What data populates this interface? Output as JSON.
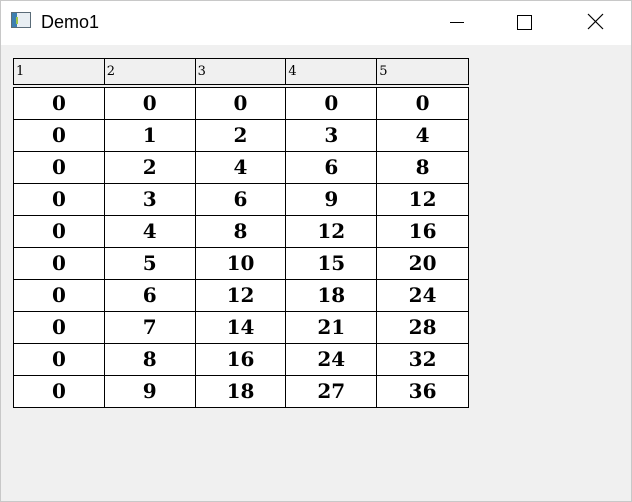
{
  "window": {
    "title": "Demo1",
    "controls": {
      "minimize": "minimize-icon",
      "maximize": "maximize-icon",
      "close": "close-icon"
    }
  },
  "table": {
    "headers": [
      "1",
      "2",
      "3",
      "4",
      "5"
    ],
    "rows": [
      [
        "0",
        "0",
        "0",
        "0",
        "0"
      ],
      [
        "0",
        "1",
        "2",
        "3",
        "4"
      ],
      [
        "0",
        "2",
        "4",
        "6",
        "8"
      ],
      [
        "0",
        "3",
        "6",
        "9",
        "12"
      ],
      [
        "0",
        "4",
        "8",
        "12",
        "16"
      ],
      [
        "0",
        "5",
        "10",
        "15",
        "20"
      ],
      [
        "0",
        "6",
        "12",
        "18",
        "24"
      ],
      [
        "0",
        "7",
        "14",
        "21",
        "28"
      ],
      [
        "0",
        "8",
        "16",
        "24",
        "32"
      ],
      [
        "0",
        "9",
        "18",
        "27",
        "36"
      ]
    ]
  }
}
